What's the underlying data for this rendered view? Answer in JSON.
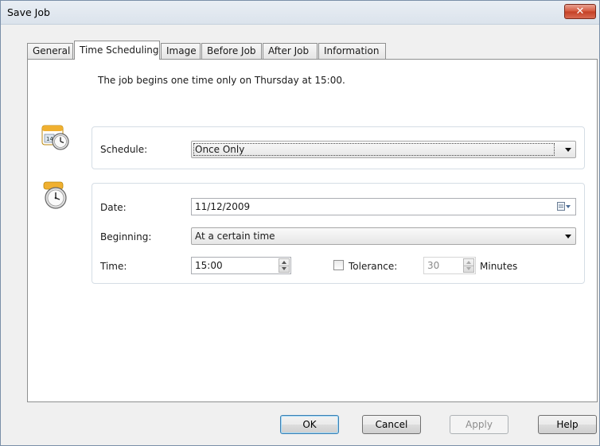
{
  "window": {
    "title": "Save Job",
    "close_label": "✕"
  },
  "tabs": [
    {
      "label": "General"
    },
    {
      "label": "Time Scheduling"
    },
    {
      "label": "Image"
    },
    {
      "label": "Before Job"
    },
    {
      "label": "After Job"
    },
    {
      "label": "Information"
    }
  ],
  "active_tab": "Time Scheduling",
  "summary": "The job begins one time only on Thursday at 15:00.",
  "schedule": {
    "label": "Schedule:",
    "value": "Once Only",
    "icon": "calendar-clock-icon"
  },
  "timing": {
    "icon": "alarm-clock-icon",
    "date_label": "Date:",
    "date_value": "11/12/2009",
    "beginning_label": "Beginning:",
    "beginning_value": "At a certain time",
    "time_label": "Time:",
    "time_value": "15:00",
    "tolerance_label": "Tolerance:",
    "tolerance_checked": false,
    "tolerance_value": "30",
    "tolerance_unit": "Minutes"
  },
  "buttons": {
    "ok": "OK",
    "cancel": "Cancel",
    "apply": "Apply",
    "help": "Help"
  },
  "colors": {
    "close_button": "#c43f24",
    "default_button_border": "#3c7fb1"
  }
}
